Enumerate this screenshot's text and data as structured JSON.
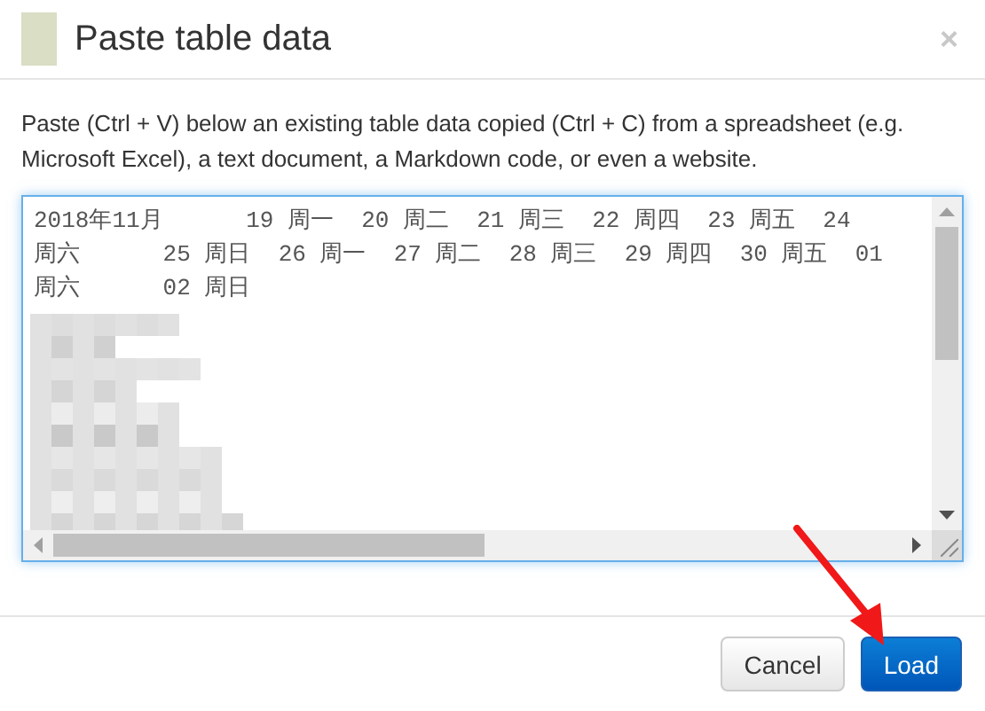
{
  "dialog": {
    "title": "Paste table data",
    "close_label": "×"
  },
  "instructions": "Paste (Ctrl + V) below an existing table data copied (Ctrl + C) from a spreadsheet (e.g. Microsoft Excel), a text document, a Markdown code, or even a website.",
  "paste_field": {
    "lines": [
      "2018年11月      19 周一  20 周二  21 周三  22 周四  23 周五  24",
      "周六      25 周日  26 周一  27 周二  28 周三  29 周四  30 周五  01",
      "周六      02 周日"
    ],
    "focused": true
  },
  "buttons": [
    {
      "label": "Cancel",
      "kind": "default"
    },
    {
      "label": "Load",
      "kind": "primary"
    }
  ]
}
